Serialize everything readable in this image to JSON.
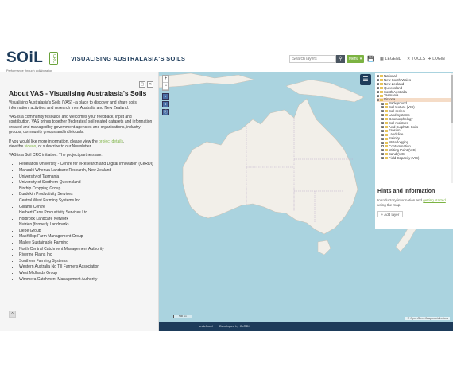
{
  "header": {
    "logo_text": "SOiL",
    "logo_badge": "CRC",
    "logo_tagline": "Performance through collaboration",
    "app_title": "VISUALISING AUSTRALASIA'S SOILS",
    "search_placeholder": "Search layers",
    "menu_label": "Menu ▾",
    "nav": [
      {
        "icon": "legend-icon",
        "label": "LEGEND"
      },
      {
        "icon": "tools-icon",
        "label": "TOOLS"
      },
      {
        "icon": "login-icon",
        "label": "LOGIN"
      }
    ]
  },
  "panel": {
    "title": "About VAS - Visualising Australasia's Soils",
    "p1": "Visualising Australasia's Soils (VAS) - a place to discover and share soils information, activities and research from Australia and New Zealand.",
    "p2": "VAS is a community resource and welcomes your feedback, input and contribution. VAS brings together (federates) soil related datasets and information created and managed by government agencies and organisations, industry groups, community groups and individuals.",
    "p3_a": "If you would like more information, please view the ",
    "p3_link1": "project details",
    "p3_b": ",",
    "p3_c": "view the ",
    "p3_link2": "videos",
    "p3_d": ", or subscribe to our Newsletter.",
    "p4": "VAS is a Soil CRC initiative. The project partners are:",
    "partners": [
      "Federation University - Centre for eResearch and Digital Innovation (CeRDI)",
      "Manaaki Whenua Landcare Research, New Zealand",
      "University of Tasmania",
      "University of Southern Queensland",
      "Birchip Cropping Group",
      "Burdekin Productivity Services",
      "Central West Farming Systems Inc",
      "Gillamii Centre",
      "Herbert Cane Productivity Services Ltd",
      "Holbrook Landcare Network",
      "Nutrien (formerly Landmark)",
      "Liebe Group",
      "MacKillop Farm Management Group",
      "Mallee Sustainable Farming",
      "North Central Catchment Management Authority",
      "Riverine Plains Inc",
      "Southern Farming Systems",
      "Western Australia No Till Farmers Association",
      "West Midlands Group",
      "Wimmera Catchment Management Authority"
    ]
  },
  "layer_tree": [
    {
      "label": "National",
      "indent": 0,
      "expand": "+"
    },
    {
      "label": "New South Wales",
      "indent": 0,
      "expand": "+"
    },
    {
      "label": "New Zealand",
      "indent": 0,
      "expand": "+"
    },
    {
      "label": "Queensland",
      "indent": 0,
      "expand": "+"
    },
    {
      "label": "South Australia",
      "indent": 0,
      "expand": "+"
    },
    {
      "label": "Tasmania",
      "indent": 0,
      "expand": "+"
    },
    {
      "label": "Victoria",
      "indent": 0,
      "expand": "-",
      "selected": true
    },
    {
      "label": "Background",
      "indent": 1,
      "expand": "+"
    },
    {
      "label": "Soil texture (VIC)",
      "indent": 1,
      "expand": "+"
    },
    {
      "label": "Soil series",
      "indent": 1,
      "expand": "+"
    },
    {
      "label": "Land systems",
      "indent": 1,
      "expand": "+"
    },
    {
      "label": "Geomorphology",
      "indent": 1,
      "expand": "+"
    },
    {
      "label": "Soil moisture",
      "indent": 1,
      "expand": "+"
    },
    {
      "label": "Acid Sulphate Soils",
      "indent": 1,
      "expand": "+"
    },
    {
      "label": "Erosion",
      "indent": 1,
      "expand": "+"
    },
    {
      "label": "Landslide",
      "indent": 1,
      "expand": "+"
    },
    {
      "label": "Salinity",
      "indent": 1,
      "expand": "+"
    },
    {
      "label": "Waterlogging",
      "indent": 1,
      "expand": "+"
    },
    {
      "label": "Contamination",
      "indent": 1,
      "expand": "+"
    },
    {
      "label": "Wilting Point (VIC)",
      "indent": 1,
      "expand": "+"
    },
    {
      "label": "Sand (VIC)",
      "indent": 1,
      "expand": "+"
    },
    {
      "label": "Field Capacity (VIC)",
      "indent": 1,
      "expand": "+"
    }
  ],
  "hints": {
    "title": "Hints and Information",
    "body_a": "Introductory information and ",
    "body_link": "getting started",
    "body_b": " using the map.",
    "add_layer": "+ Add layer"
  },
  "map": {
    "credit": "© OpenStreetMap contributors",
    "scale_label": "500 km"
  },
  "footer": {
    "left": "undefined",
    "right": "Developed by CeRDI"
  },
  "colors": {
    "brand_navy": "#1d3b5a",
    "accent_green": "#7cb342",
    "water": "#aad3df",
    "land": "#f2efe9"
  }
}
